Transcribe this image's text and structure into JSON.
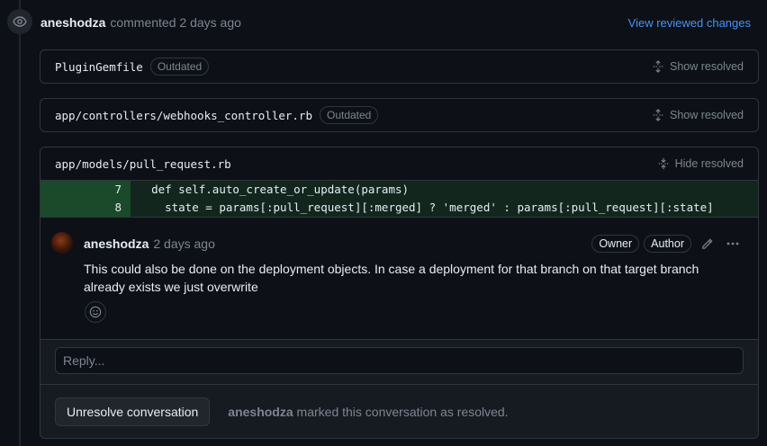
{
  "review": {
    "author": "aneshodza",
    "action_text": "commented 2 days ago",
    "view_changes_label": "View reviewed changes"
  },
  "files": [
    {
      "name": "PluginGemfile",
      "label": "Outdated",
      "toggle_label": "Show resolved"
    },
    {
      "name": "app/controllers/webhooks_controller.rb",
      "label": "Outdated",
      "toggle_label": "Show resolved"
    },
    {
      "name": "app/models/pull_request.rb",
      "label": "",
      "toggle_label": "Hide resolved"
    }
  ],
  "diff": [
    {
      "line": "7",
      "indent": "  ",
      "code": "def self.auto_create_or_update(params)"
    },
    {
      "line": "8",
      "indent": "    ",
      "code": "state = params[:pull_request][:merged] ? 'merged' : params[:pull_request][:state]"
    }
  ],
  "comment": {
    "author": "aneshodza",
    "time": "2 days ago",
    "badges": [
      "Owner",
      "Author"
    ],
    "body": "This could also be done on the deployment objects. In case a deployment for that branch on that target branch already exists we just overwrite"
  },
  "reply": {
    "placeholder": "Reply..."
  },
  "resolution": {
    "button_label": "Unresolve conversation",
    "actor": "aneshodza",
    "text": "marked this conversation as resolved."
  },
  "colors": {
    "accent": "#4493f8",
    "added_bg": "#12261e",
    "added_num_bg": "#1a4a2a"
  },
  "icons": [
    "eye-icon",
    "unfold-icon",
    "fold-icon",
    "pencil-icon",
    "kebab-icon",
    "smiley-icon"
  ]
}
